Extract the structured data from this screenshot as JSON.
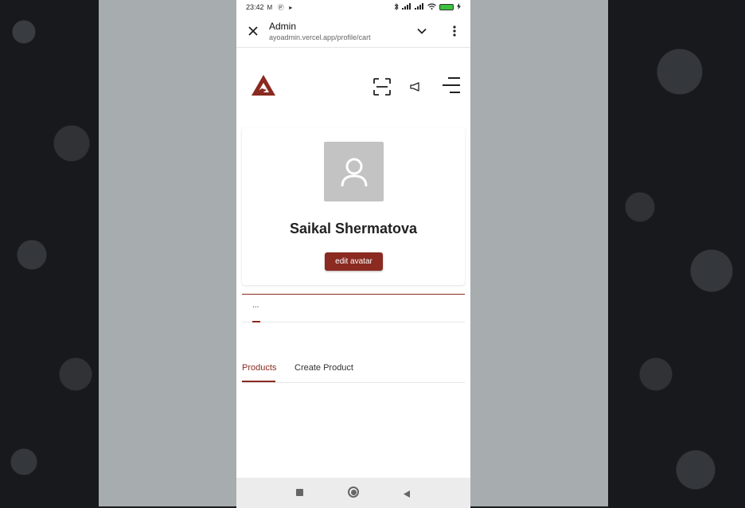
{
  "status_bar": {
    "time": "23:42",
    "left_icons": [
      "M",
      "Ⓟ",
      "▸"
    ],
    "battery_level": 100,
    "battery_color": "#3cc23c"
  },
  "browser": {
    "title": "Admin",
    "url": "ayoadmin.vercel.app/profile/cart"
  },
  "profile": {
    "name": "Saikal Shermatova",
    "edit_avatar_label": "edit avatar"
  },
  "loading": {
    "text": "..."
  },
  "tabs": [
    {
      "label": "Products",
      "active": true
    },
    {
      "label": "Create Product",
      "active": false
    }
  ],
  "colors": {
    "accent": "#8a2a20",
    "avatar_bg": "#c3c3c3"
  },
  "icons": {
    "header": [
      "logo-icon",
      "scan-icon",
      "megaphone-icon",
      "menu-icon"
    ],
    "browser": [
      "close-icon",
      "chevron-down-icon",
      "more-vert-icon"
    ],
    "nav": [
      "recents-icon",
      "home-icon",
      "back-icon"
    ]
  }
}
